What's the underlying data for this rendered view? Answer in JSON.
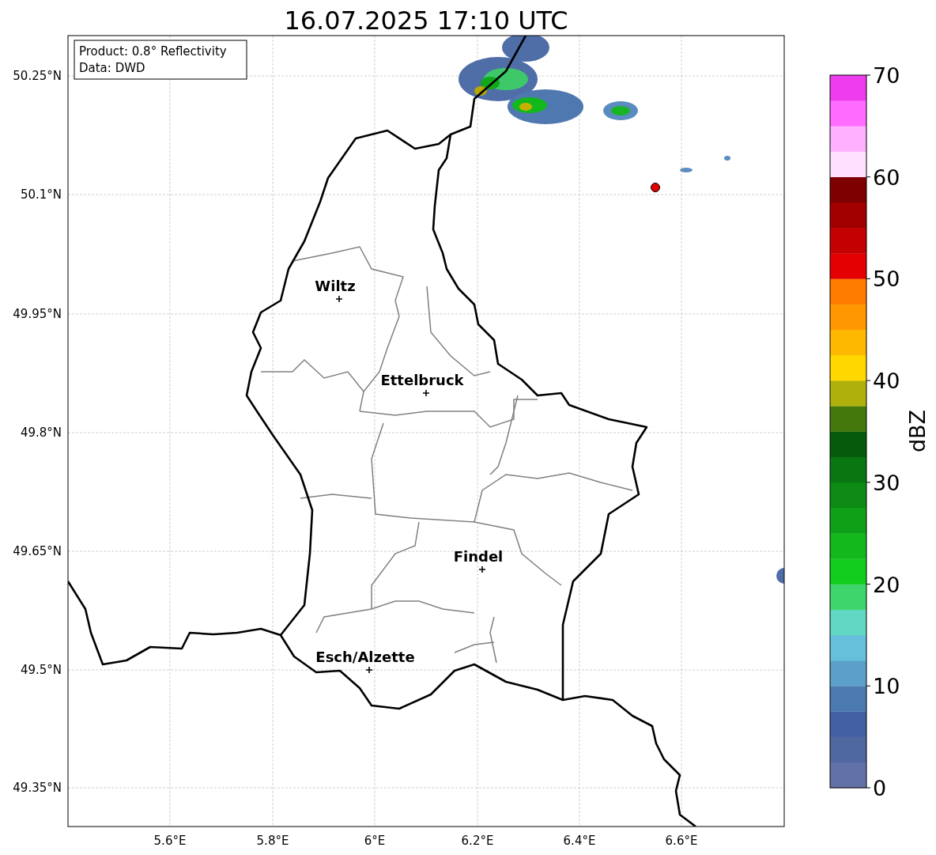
{
  "title": "16.07.2025 17:10 UTC",
  "info_box": [
    "Product: 0.8° Reflectivity",
    "Data: DWD"
  ],
  "lat_ticks": [
    "50.25°N",
    "50.1°N",
    "49.95°N",
    "49.8°N",
    "49.65°N",
    "49.5°N",
    "49.35°N"
  ],
  "lon_ticks": [
    "5.6°E",
    "5.8°E",
    "6°E",
    "6.2°E",
    "6.4°E",
    "6.6°E"
  ],
  "cities": [
    {
      "name": "Wiltz"
    },
    {
      "name": "Ettelbruck"
    },
    {
      "name": "Findel"
    },
    {
      "name": "Esch/Alzette"
    }
  ],
  "colorbar": {
    "label": "dBZ",
    "ticks": [
      "70",
      "60",
      "50",
      "40",
      "30",
      "20",
      "10",
      "0"
    ],
    "bands": [
      {
        "color": "#6272a8"
      },
      {
        "color": "#5068a0"
      },
      {
        "color": "#4460a4"
      },
      {
        "color": "#4a7ab0"
      },
      {
        "color": "#5aa0c8"
      },
      {
        "color": "#66c0dc"
      },
      {
        "color": "#60d8c4"
      },
      {
        "color": "#3ed66c"
      },
      {
        "color": "#12cc1e"
      },
      {
        "color": "#12b81c"
      },
      {
        "color": "#10a018"
      },
      {
        "color": "#0c8a14"
      },
      {
        "color": "#0a7612"
      },
      {
        "color": "#065a0c"
      },
      {
        "color": "#44780c"
      },
      {
        "color": "#b0b00a"
      },
      {
        "color": "#ffd800"
      },
      {
        "color": "#ffb800"
      },
      {
        "color": "#ff9800"
      },
      {
        "color": "#ff7c00"
      },
      {
        "color": "#e40000"
      },
      {
        "color": "#c40000"
      },
      {
        "color": "#a20000"
      },
      {
        "color": "#7e0000"
      },
      {
        "color": "#ffe0ff"
      },
      {
        "color": "#ffb0ff"
      },
      {
        "color": "#ff6cff"
      },
      {
        "color": "#ee3cee"
      }
    ]
  }
}
